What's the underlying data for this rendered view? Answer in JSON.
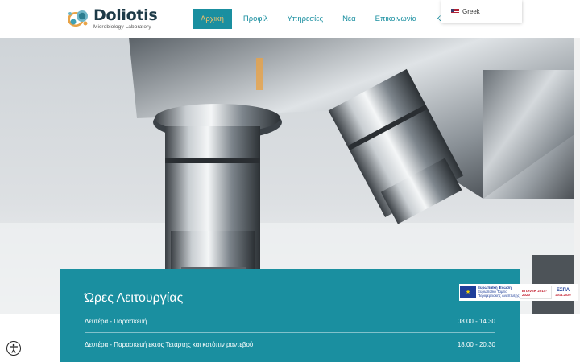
{
  "header": {
    "logo": {
      "title": "Doliotis",
      "subtitle": "Microbiology Laboratory"
    },
    "nav": [
      {
        "label": "Αρχική",
        "active": true
      },
      {
        "label": "Προφίλ"
      },
      {
        "label": "Υπηρεσίες"
      },
      {
        "label": "Νέα"
      },
      {
        "label": "Επικοινωνία"
      },
      {
        "label": "Καλάθι"
      }
    ],
    "language": {
      "label": "Greek",
      "icon": "us-flag-icon"
    }
  },
  "hero": {
    "image": "microscope-photo"
  },
  "hours": {
    "title": "Ώρες Λειτουργίας",
    "rows": [
      {
        "days": "Δευτέρα - Παρασκευή",
        "time": "08.00 - 14.30"
      },
      {
        "days": "Δευτέρα - Παρασκευή εκτός Τετάρτης και κατόπιν ραντεβού",
        "time": "18.00 - 20.30"
      }
    ]
  },
  "eu_banner": {
    "eu_text": "Ευρωπαϊκή Ένωση",
    "eu_sub": "Ευρωπαϊκό Ταμείο Περιφερειακής Ανάπτυξης",
    "epanek": "ΕΠΑνΕΚ 2014-2020",
    "espa": "ΕΣΠΑ",
    "espa_years": "2014-2020"
  },
  "accessibility": {
    "icon": "accessibility-icon"
  },
  "colors": {
    "teal": "#1a8fa0",
    "active_text": "#f3c26b",
    "logo_dark": "#1d3a47"
  }
}
